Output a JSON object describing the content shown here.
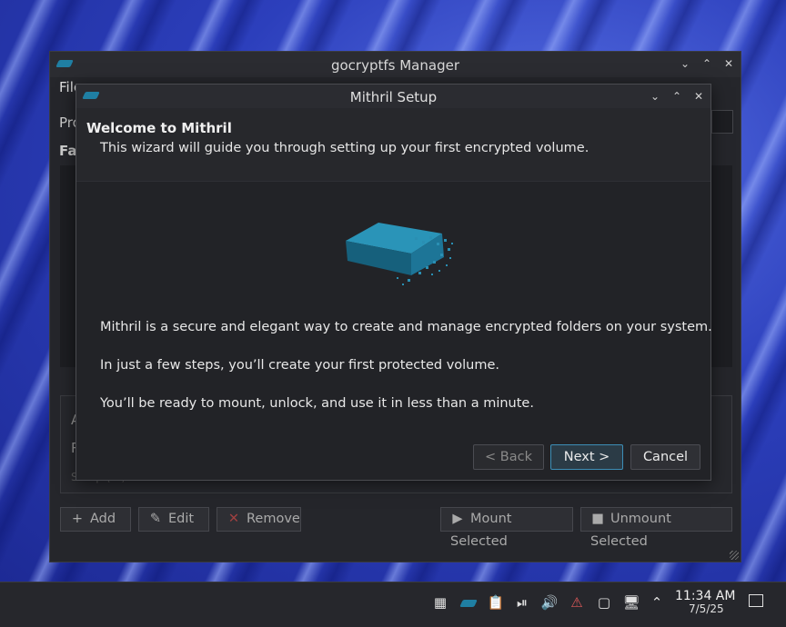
{
  "main_window": {
    "title": "gocryptfs Manager",
    "menu_partial": "File",
    "partial_labels": [
      "Pro",
      "Fav"
    ],
    "detail_partials": [
      "A",
      "R",
      "Setup (…)"
    ],
    "buttons": {
      "add": "Add",
      "edit": "Edit",
      "remove": "Remove",
      "mount": "Mount Selected",
      "unmount": "Unmount Selected"
    }
  },
  "dialog": {
    "title": "Mithril Setup",
    "heading": "Welcome to Mithril",
    "subtitle": "This wizard will guide you through setting up your first encrypted volume.",
    "paragraphs": [
      "Mithril is a secure and elegant way to create and manage encrypted folders on your system.",
      "In just a few steps, you’ll create your first protected volume.",
      "You’ll be ready to mount, unlock, and use it in less than a minute."
    ],
    "buttons": {
      "back": "< Back",
      "next": "Next >",
      "cancel": "Cancel"
    }
  },
  "taskbar": {
    "time": "11:34 AM",
    "date": "7/5/25"
  },
  "colors": {
    "accent": "#3d8eb6",
    "logo": "#1f7fa3",
    "window_bg": "#222327"
  }
}
